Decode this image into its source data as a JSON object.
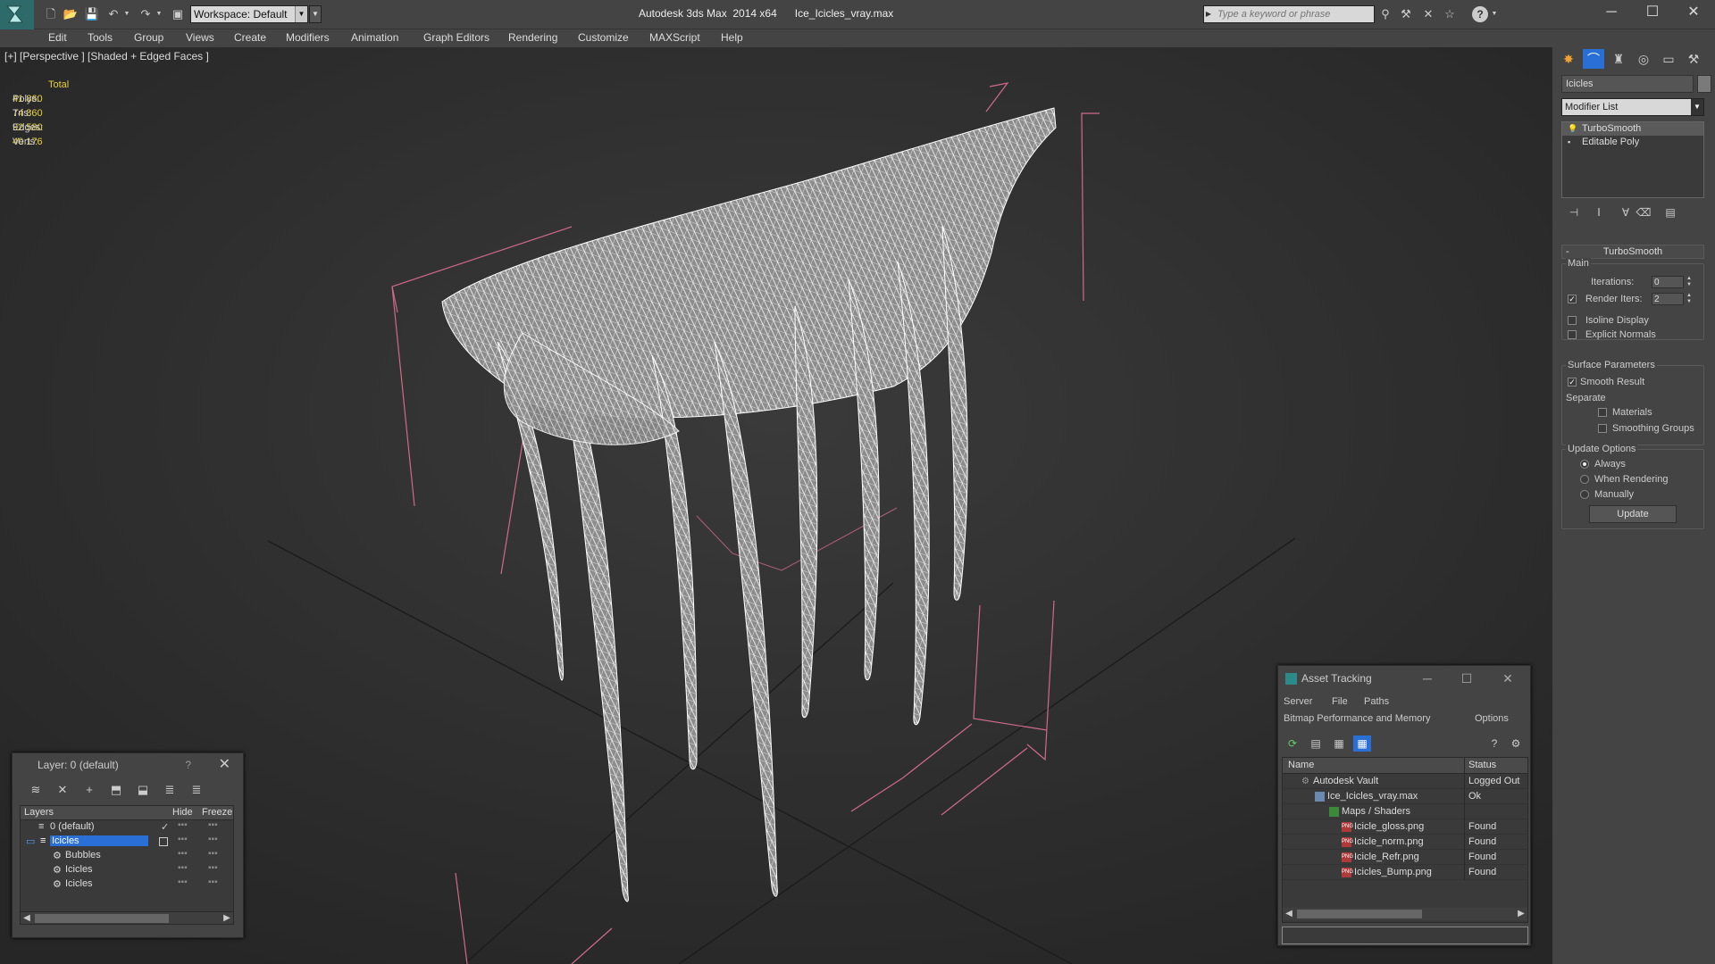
{
  "titlebar": {
    "title": "Autodesk 3ds Max  2014 x64      Ice_Icicles_vray.max",
    "workspace": "Workspace: Default",
    "search_placeholder": "Type a keyword or phrase",
    "logo_icon": "3ds-max-logo-icon"
  },
  "menu": [
    "Edit",
    "Tools",
    "Group",
    "Views",
    "Create",
    "Modifiers",
    "Animation",
    "Graph Editors",
    "Rendering",
    "Customize",
    "MAXScript",
    "Help"
  ],
  "viewport": {
    "label": "[+] [Perspective ] [Shaded + Edged Faces ]",
    "stats": {
      "header": "Total",
      "rows": [
        {
          "label": "Polys:",
          "value": "41 860"
        },
        {
          "label": "Tris:",
          "value": "74 860"
        },
        {
          "label": "Edges:",
          "value": "92 580"
        },
        {
          "label": "Verts:",
          "value": "40 176"
        }
      ]
    }
  },
  "command_panel": {
    "object_name": "Icicles",
    "modifier_list": "Modifier List",
    "stack": [
      "TurboSmooth",
      "Editable Poly"
    ],
    "turbosmooth": {
      "title": "TurboSmooth",
      "main_label": "Main",
      "iterations_label": "Iterations:",
      "iterations_value": "0",
      "render_iters_label": "Render Iters:",
      "render_iters_value": "2",
      "isoline_display": "Isoline Display",
      "explicit_normals": "Explicit Normals",
      "surface_params": "Surface Parameters",
      "smooth_result": "Smooth Result",
      "separate": "Separate",
      "materials": "Materials",
      "smoothing_groups": "Smoothing Groups",
      "update_options": "Update Options",
      "always": "Always",
      "when_rendering": "When Rendering",
      "manually": "Manually",
      "update_btn": "Update"
    }
  },
  "layer_window": {
    "title": "Layer: 0 (default)",
    "help": "?",
    "columns": [
      "Layers",
      "Hide",
      "Freeze"
    ],
    "rows": [
      {
        "name": "0 (default)",
        "indent": 1
      },
      {
        "name": "Icicles",
        "indent": 1,
        "selected": true
      },
      {
        "name": "Bubbles",
        "indent": 2
      },
      {
        "name": "Icicles",
        "indent": 2
      },
      {
        "name": "Icicles",
        "indent": 2
      }
    ]
  },
  "asset_window": {
    "title": "Asset Tracking",
    "menu": [
      "Server",
      "File",
      "Paths",
      "Bitmap Performance and Memory",
      "Options"
    ],
    "columns": [
      "Name",
      "Status"
    ],
    "rows": [
      {
        "name": "Autodesk Vault",
        "status": "Logged Out"
      },
      {
        "name": "Ice_Icicles_vray.max",
        "status": "Ok"
      },
      {
        "name": "Maps / Shaders",
        "status": ""
      },
      {
        "name": "Icicle_gloss.png",
        "status": "Found"
      },
      {
        "name": "Icicle_norm.png",
        "status": "Found"
      },
      {
        "name": "Icicle_Refr.png",
        "status": "Found"
      },
      {
        "name": "Icicles_Bump.png",
        "status": "Found"
      }
    ]
  },
  "colors": {
    "accent": "#2a6fd6",
    "stats": "#e8d040",
    "bbox": "#d06a8a",
    "wire": "#ffffff"
  }
}
